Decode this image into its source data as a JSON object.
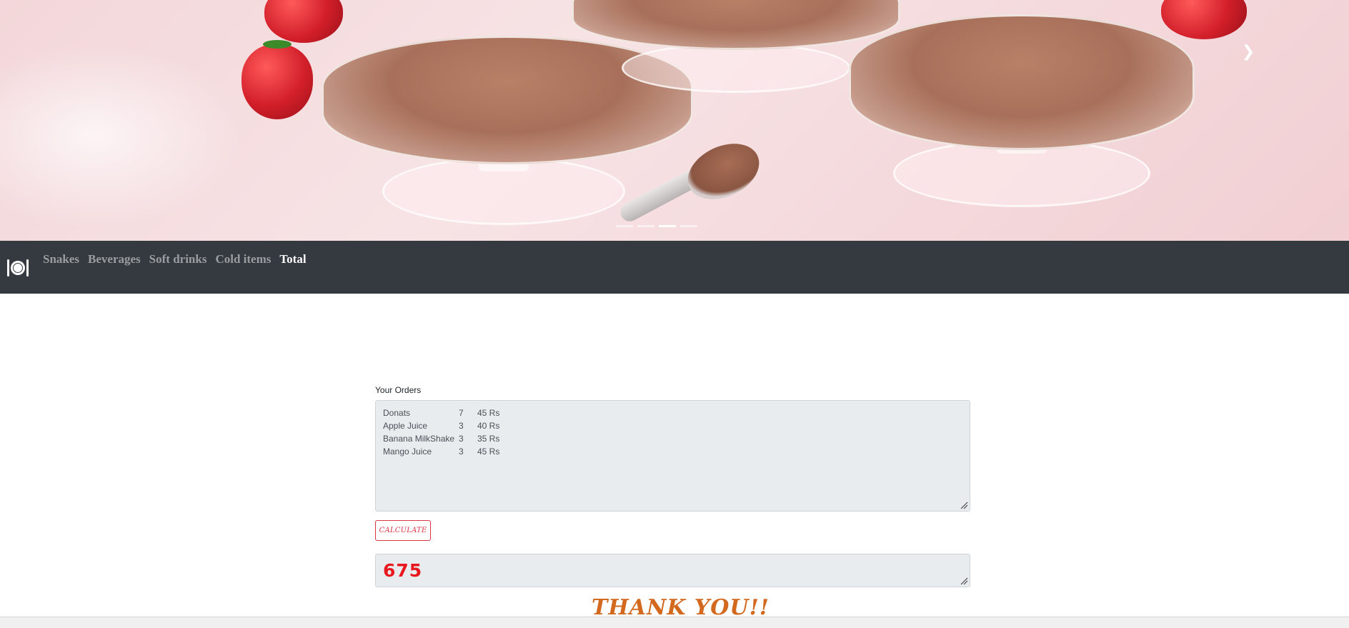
{
  "carousel": {
    "next_icon": "chevron-right-icon",
    "indicator_count": 4,
    "active_indicator": 2
  },
  "navbar": {
    "brand_icon": "plate-cutlery-icon",
    "links": [
      {
        "label": "Snakes",
        "active": false
      },
      {
        "label": "Beverages",
        "active": false
      },
      {
        "label": "Soft drinks",
        "active": false
      },
      {
        "label": "Cold items",
        "active": false
      },
      {
        "label": "Total",
        "active": true
      }
    ]
  },
  "orders": {
    "label": "Your Orders",
    "rows": [
      {
        "item": "Donats",
        "qty": "7",
        "price": "45 Rs"
      },
      {
        "item": "Apple Juice",
        "qty": "3",
        "price": "40 Rs"
      },
      {
        "item": "Banana MilkShake",
        "qty": "3",
        "price": "35 Rs"
      },
      {
        "item": "Mango Juice",
        "qty": "3",
        "price": "45 Rs"
      }
    ]
  },
  "calculate_label": "CALCULATE",
  "total_value": "675",
  "thanks_text": "THANK YOU!!",
  "colors": {
    "navbar_bg": "#343a40",
    "danger": "#dc3545",
    "total_text": "#e8181f",
    "thanks_text": "#d2691e"
  }
}
